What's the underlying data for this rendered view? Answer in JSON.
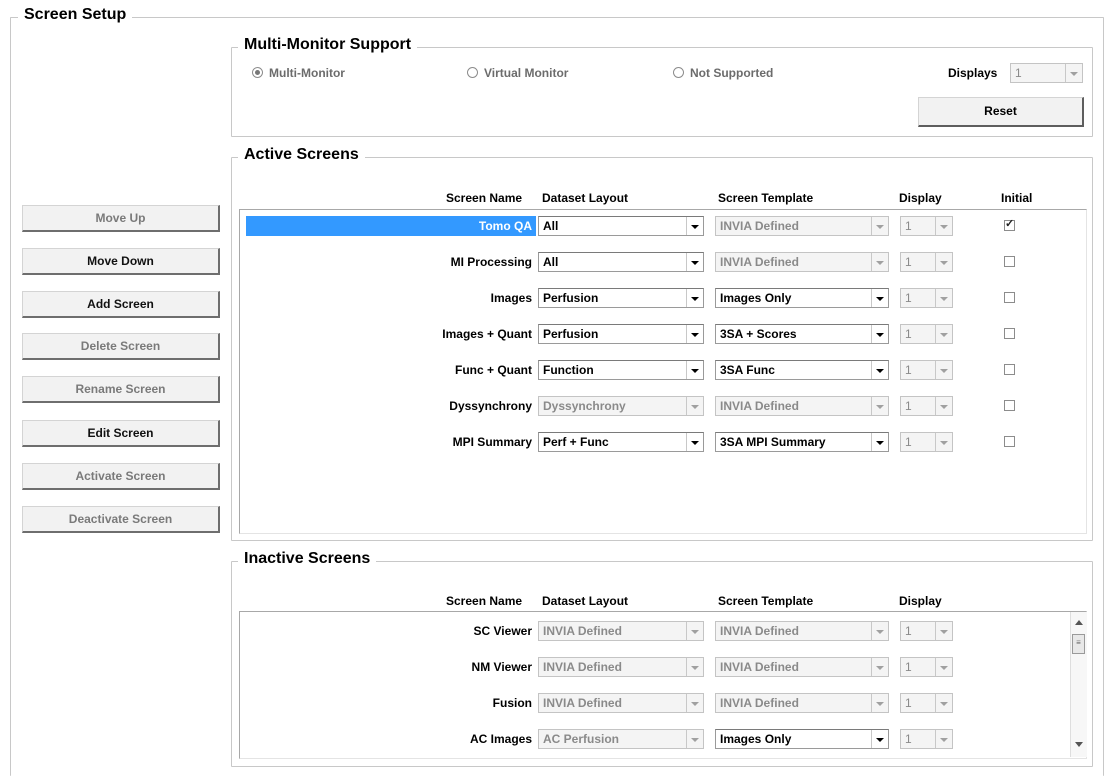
{
  "screen_setup": {
    "title": "Screen Setup"
  },
  "sidebar": {
    "buttons": [
      {
        "label": "Move Up",
        "enabled": false
      },
      {
        "label": "Move Down",
        "enabled": true
      },
      {
        "label": "Add Screen",
        "enabled": true
      },
      {
        "label": "Delete Screen",
        "enabled": false
      },
      {
        "label": "Rename Screen",
        "enabled": false
      },
      {
        "label": "Edit Screen",
        "enabled": true
      },
      {
        "label": "Activate Screen",
        "enabled": false
      },
      {
        "label": "Deactivate Screen",
        "enabled": false
      }
    ]
  },
  "multi_monitor": {
    "title": "Multi-Monitor Support",
    "options": [
      {
        "label": "Multi-Monitor",
        "selected": true
      },
      {
        "label": "Virtual Monitor",
        "selected": false
      },
      {
        "label": "Not Supported",
        "selected": false
      }
    ],
    "displays_label": "Displays",
    "displays_value": "1",
    "reset_label": "Reset"
  },
  "active_screens": {
    "title": "Active Screens",
    "headers": {
      "screen_name": "Screen Name",
      "dataset_layout": "Dataset Layout",
      "screen_template": "Screen Template",
      "display": "Display",
      "initial": "Initial"
    },
    "rows": [
      {
        "name": "Tomo QA",
        "selected": true,
        "dataset": "All",
        "dataset_enabled": true,
        "template": "INVIA Defined",
        "template_enabled": false,
        "display": "1",
        "initial": true
      },
      {
        "name": "MI Processing",
        "selected": false,
        "dataset": "All",
        "dataset_enabled": true,
        "template": "INVIA Defined",
        "template_enabled": false,
        "display": "1",
        "initial": false
      },
      {
        "name": "Images",
        "selected": false,
        "dataset": "Perfusion",
        "dataset_enabled": true,
        "template": "Images Only",
        "template_enabled": true,
        "display": "1",
        "initial": false
      },
      {
        "name": "Images + Quant",
        "selected": false,
        "dataset": "Perfusion",
        "dataset_enabled": true,
        "template": "3SA + Scores",
        "template_enabled": true,
        "display": "1",
        "initial": false
      },
      {
        "name": "Func + Quant",
        "selected": false,
        "dataset": "Function",
        "dataset_enabled": true,
        "template": "3SA Func",
        "template_enabled": true,
        "display": "1",
        "initial": false
      },
      {
        "name": "Dyssynchrony",
        "selected": false,
        "dataset": "Dyssynchrony",
        "dataset_enabled": false,
        "template": "INVIA Defined",
        "template_enabled": false,
        "display": "1",
        "initial": false
      },
      {
        "name": "MPI Summary",
        "selected": false,
        "dataset": "Perf + Func",
        "dataset_enabled": true,
        "template": "3SA MPI Summary",
        "template_enabled": true,
        "display": "1",
        "initial": false
      }
    ]
  },
  "inactive_screens": {
    "title": "Inactive Screens",
    "headers": {
      "screen_name": "Screen Name",
      "dataset_layout": "Dataset Layout",
      "screen_template": "Screen Template",
      "display": "Display"
    },
    "rows": [
      {
        "name": "SC Viewer",
        "dataset": "INVIA Defined",
        "dataset_enabled": false,
        "template": "INVIA Defined",
        "template_enabled": false,
        "display": "1"
      },
      {
        "name": "NM Viewer",
        "dataset": "INVIA Defined",
        "dataset_enabled": false,
        "template": "INVIA Defined",
        "template_enabled": false,
        "display": "1"
      },
      {
        "name": "Fusion",
        "dataset": "INVIA Defined",
        "dataset_enabled": false,
        "template": "INVIA Defined",
        "template_enabled": false,
        "display": "1"
      },
      {
        "name": "AC Images",
        "dataset": "AC Perfusion",
        "dataset_enabled": false,
        "template": "Images Only",
        "template_enabled": true,
        "display": "1"
      }
    ]
  }
}
